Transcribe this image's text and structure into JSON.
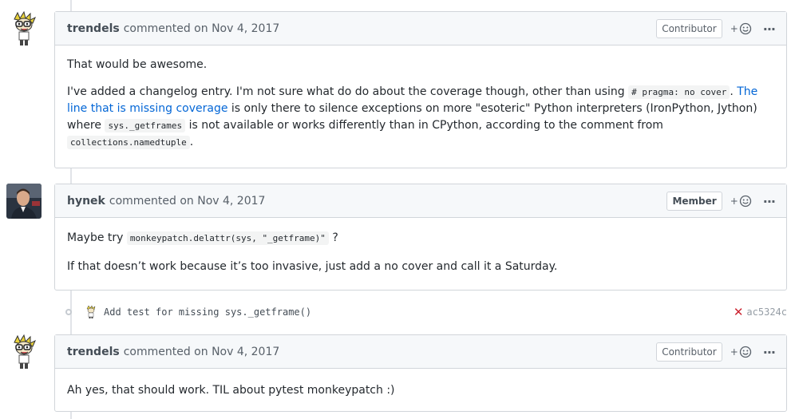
{
  "comments": [
    {
      "author": "trendels",
      "meta": "commented on Nov 4, 2017",
      "role": "Contributor",
      "body": {
        "p1": "That would be awesome.",
        "p2_a": "I've added a changelog entry. I'm not sure what do do about the coverage though, other than using ",
        "p2_code1": "# pragma: no cover",
        "p2_b": ". ",
        "p2_link": "The line that is missing coverage",
        "p2_c": " is only there to silence exceptions on more \"esoteric\" Python interpreters (IronPython, Jython) where ",
        "p2_code2": "sys._getframes",
        "p2_d": " is not available or works differently than in CPython, according to the comment from ",
        "p2_code3": "collections.namedtuple",
        "p2_e": "."
      }
    },
    {
      "author": "hynek",
      "meta": "commented on Nov 4, 2017",
      "role": "Member",
      "body": {
        "p1_a": "Maybe try ",
        "p1_code": "monkeypatch.delattr(sys, \"_getframe)\"",
        "p1_b": " ?",
        "p2": "If that doesn’t work because it’s too invasive, just add a no cover and call it a Saturday."
      }
    },
    {
      "author": "trendels",
      "meta": "commented on Nov 4, 2017",
      "role": "Contributor",
      "body": {
        "p1": "Ah yes, that should work. TIL about pytest monkeypatch :)"
      }
    }
  ],
  "commit": {
    "message": "Add test for missing sys._getframe()",
    "status_icon": "x-icon",
    "sha": "ac5324c"
  },
  "actions": {
    "reaction_plus": "+",
    "kebab": "···"
  },
  "colors": {
    "link": "#0366d6",
    "fail": "#cb2431",
    "border": "#d1d5da",
    "header_bg": "#f6f8fa"
  }
}
